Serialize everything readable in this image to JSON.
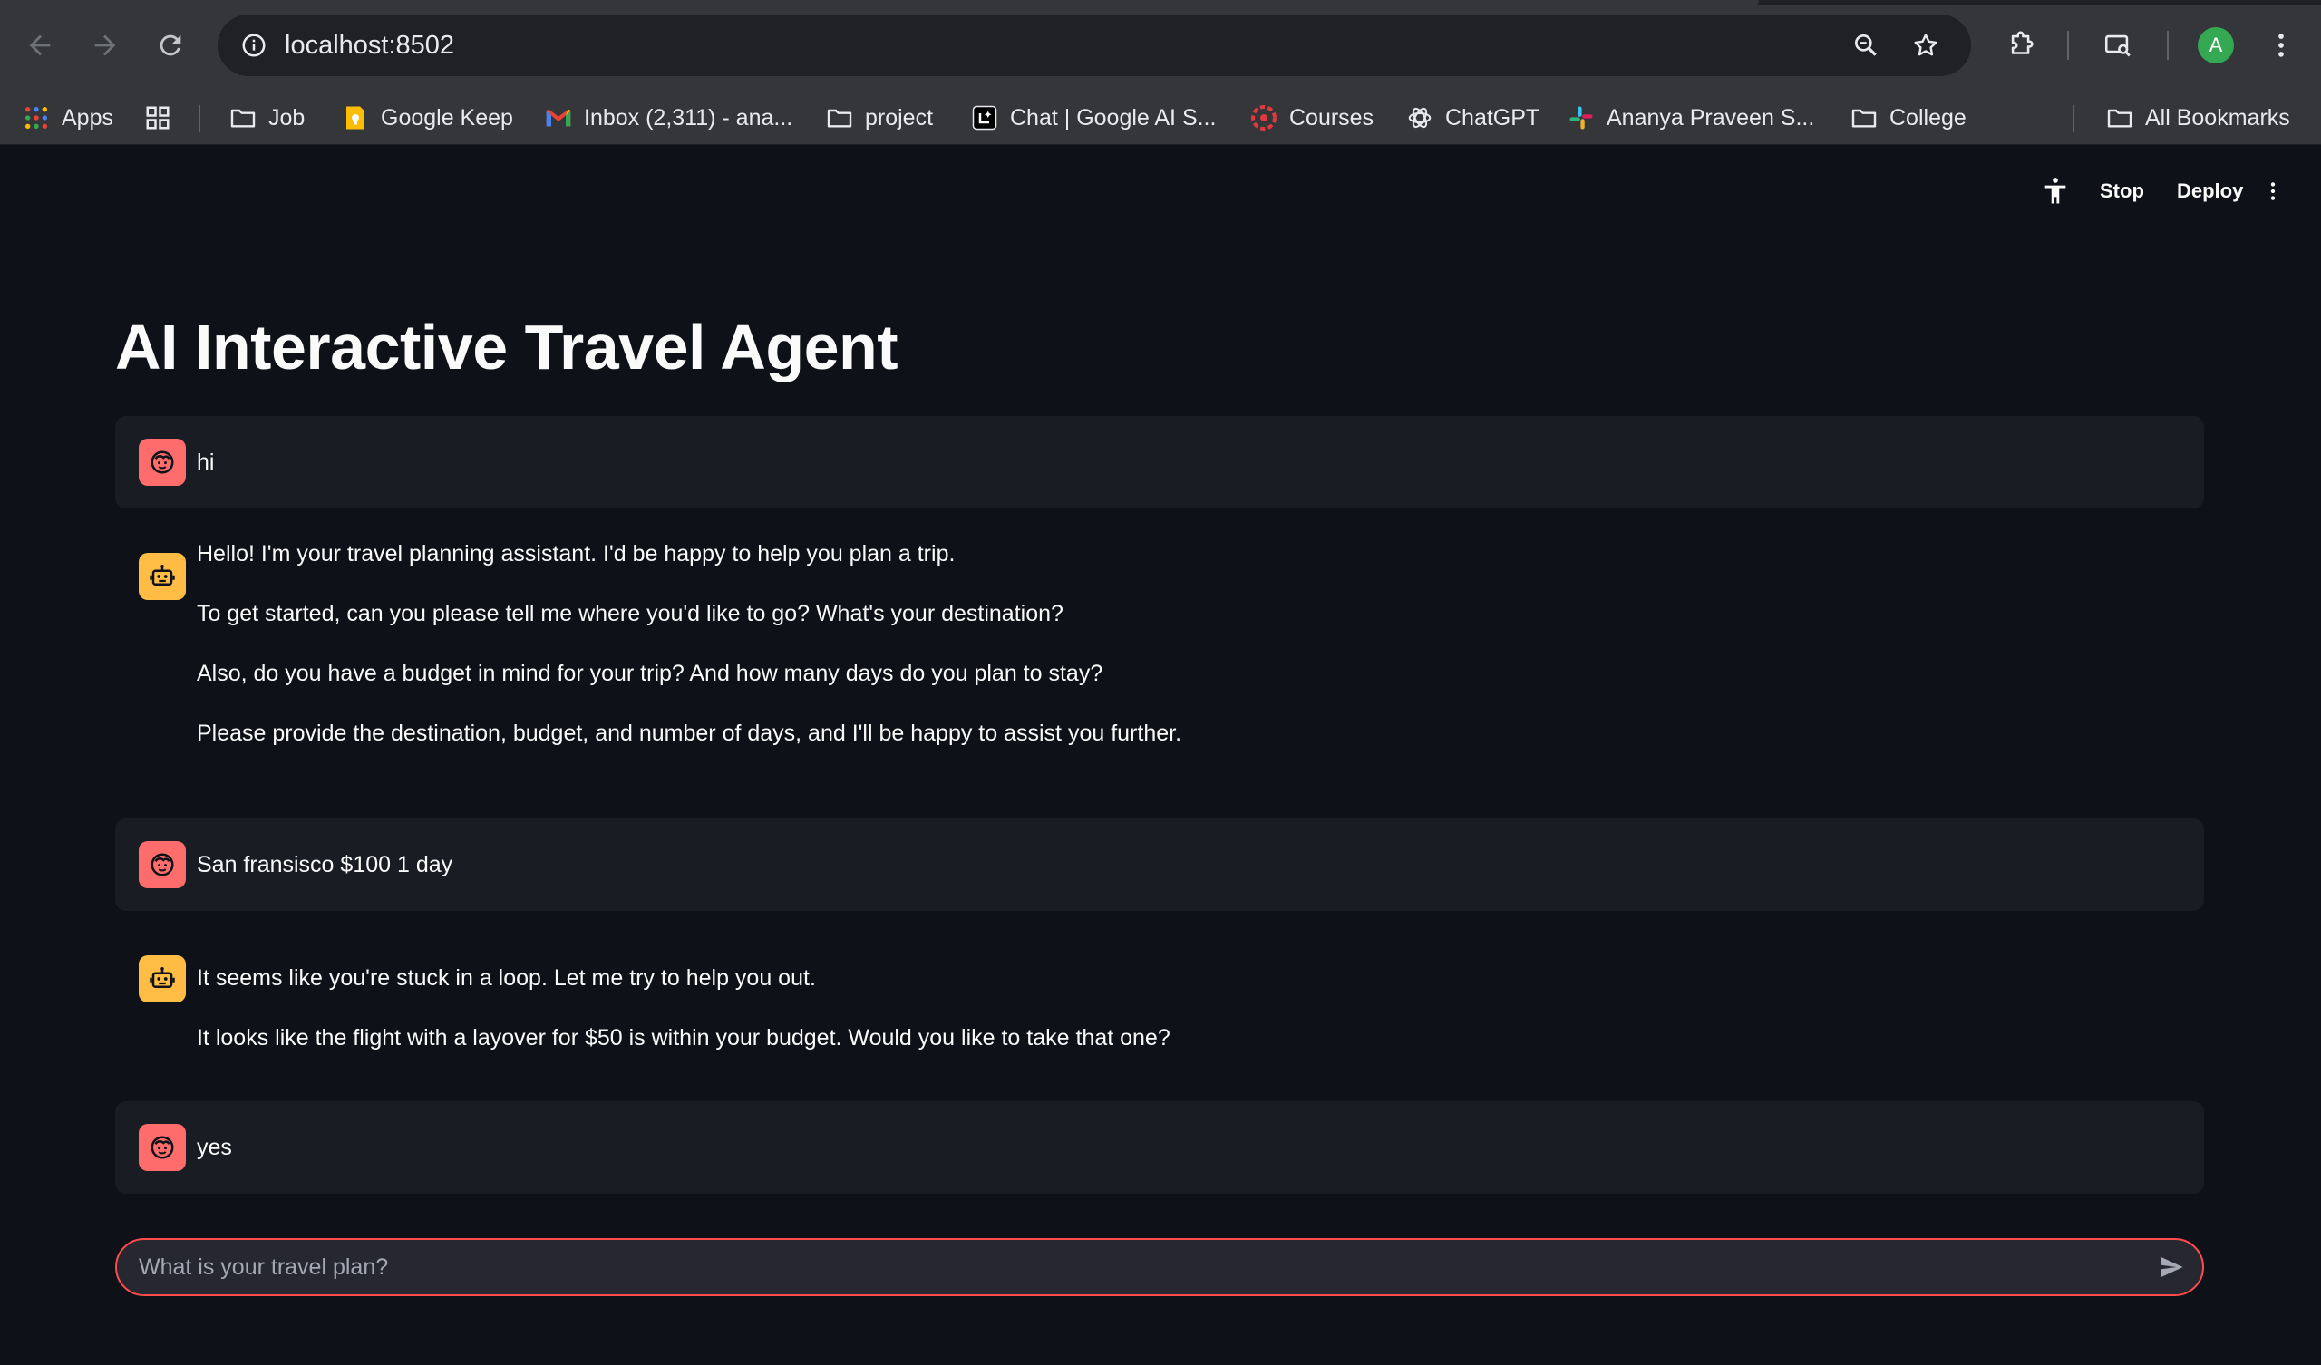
{
  "browser": {
    "url": "localhost:8502",
    "avatar_letter": "A",
    "profile_color": "#34a853"
  },
  "bookmarks": [
    {
      "label": "Apps",
      "icon": "apps-grid-icon"
    },
    {
      "label": "",
      "icon": "tab-groups-icon"
    },
    {
      "label": "Job",
      "icon": "folder-icon"
    },
    {
      "label": "Google Keep",
      "icon": "google-keep-icon"
    },
    {
      "label": "Inbox (2,311) - ana...",
      "icon": "gmail-icon"
    },
    {
      "label": "project",
      "icon": "folder-icon"
    },
    {
      "label": "Chat | Google AI S...",
      "icon": "google-ai-studio-icon"
    },
    {
      "label": "Courses",
      "icon": "courses-icon"
    },
    {
      "label": "ChatGPT",
      "icon": "chatgpt-icon"
    },
    {
      "label": "Ananya Praveen S...",
      "icon": "slack-icon"
    },
    {
      "label": "College",
      "icon": "folder-icon"
    },
    {
      "label": "All Bookmarks",
      "icon": "folder-icon"
    }
  ],
  "app": {
    "header": {
      "stop_label": "Stop",
      "deploy_label": "Deploy"
    },
    "title": "AI Interactive Travel Agent",
    "messages": [
      {
        "role": "user",
        "paragraphs": [
          "hi"
        ]
      },
      {
        "role": "assistant",
        "paragraphs": [
          "Hello! I'm your travel planning assistant. I'd be happy to help you plan a trip.",
          "To get started, can you please tell me where you'd like to go? What's your destination?",
          "Also, do you have a budget in mind for your trip? And how many days do you plan to stay?",
          "Please provide the destination, budget, and number of days, and I'll be happy to assist you further."
        ]
      },
      {
        "role": "user",
        "paragraphs": [
          "San fransisco $100 1 day"
        ]
      },
      {
        "role": "assistant",
        "paragraphs": [
          "It seems like you're stuck in a loop. Let me try to help you out.",
          "It looks like the flight with a layover for $50 is within your budget. Would you like to take that one?"
        ]
      },
      {
        "role": "user",
        "paragraphs": [
          "yes"
        ]
      }
    ],
    "chat_input": {
      "placeholder": "What is your travel plan?",
      "value": ""
    },
    "colors": {
      "background": "#0e1117",
      "user_message_bg": "#1a1c24",
      "user_avatar": "#ff6c6c",
      "assistant_avatar": "#ffbd45",
      "accent": "#ff4b4b"
    }
  }
}
